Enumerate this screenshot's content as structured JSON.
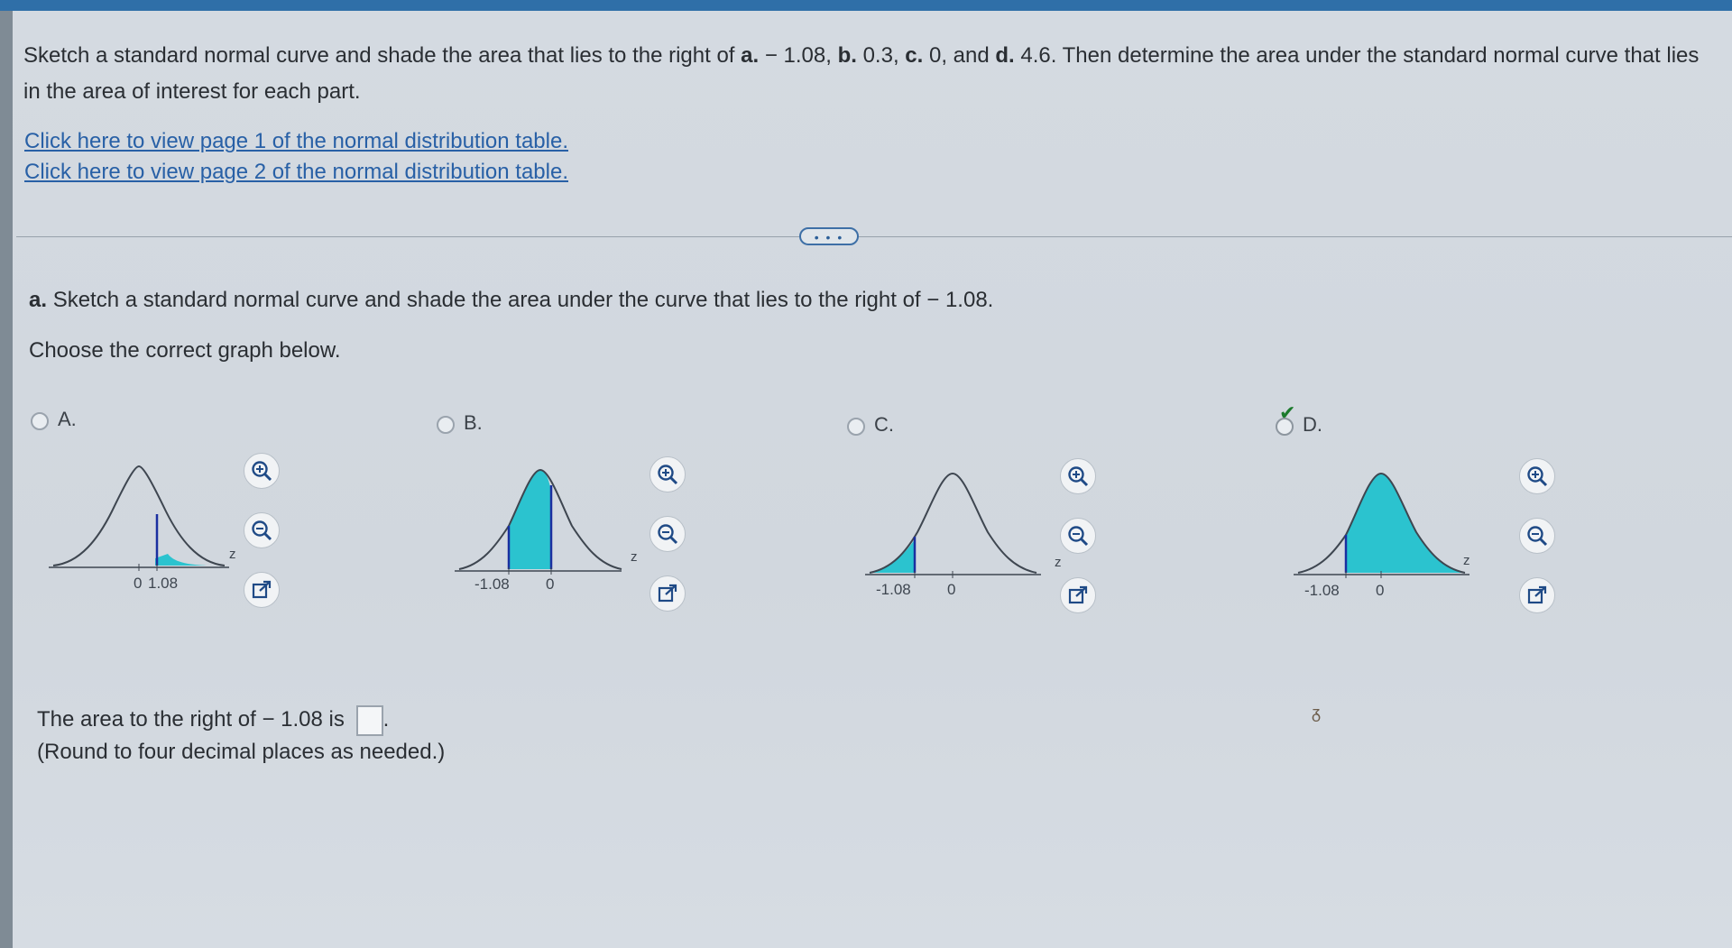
{
  "question": {
    "prefix": "Sketch a standard normal curve and shade the area that lies to the right of",
    "a_label": "a.",
    "a_value": "− 1.08,",
    "b_label": "b.",
    "b_value": "0.3,",
    "c_label": "c.",
    "c_value": "0, and",
    "d_label": "d.",
    "d_value": "4.6. Then determine the area under the standard normal curve that lies in the area of interest for each part."
  },
  "links": {
    "page1": "Click here to view page 1 of the normal distribution table.",
    "page2": "Click here to view page 2 of the normal distribution table."
  },
  "more_button": "• • •",
  "part_a": {
    "label": "a.",
    "text": "Sketch a standard normal curve and shade the area under the curve that lies to the right of − 1.08."
  },
  "choose": "Choose the correct graph below.",
  "options": [
    {
      "letter": "A.",
      "ticks": [
        "0",
        "1.08"
      ],
      "axis_label": "z",
      "selected": false
    },
    {
      "letter": "B.",
      "ticks": [
        "-1.08",
        "0"
      ],
      "axis_label": "z",
      "selected": false
    },
    {
      "letter": "C.",
      "ticks": [
        "-1.08",
        "0"
      ],
      "axis_label": "z",
      "selected": false
    },
    {
      "letter": "D.",
      "ticks": [
        "-1.08",
        "0"
      ],
      "axis_label": "z",
      "selected": true
    }
  ],
  "check_mark": "✔",
  "icons": [
    "zoom-in-icon",
    "zoom-out-icon",
    "external-link-icon"
  ],
  "answer": {
    "line1_prefix": "The area to the right of",
    "line1_value": "− 1.08 is",
    "line2": "(Round to four decimal places as needed.)"
  },
  "stray_mark": "ᵹ",
  "colors": {
    "shade": "#2bc3cf",
    "curve": "#3e4650",
    "line": "#1a2fa0",
    "link": "#2860a6",
    "check": "#1b7a2c"
  }
}
